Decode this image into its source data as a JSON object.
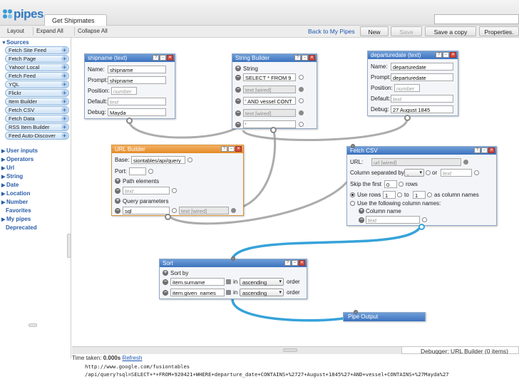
{
  "app": {
    "logo_text": "pipes",
    "pipe_tab_title": "Get Shipmates"
  },
  "toolbar": {
    "layout": "Layout",
    "expand_all": "Expand All",
    "collapse_all": "Collapse All",
    "back_link": "Back to My Pipes",
    "new": "New",
    "save": "Save",
    "save_copy": "Save a copy",
    "properties": "Properties."
  },
  "sidebar": {
    "sources_label": "Sources",
    "sources": [
      "Fetch Site Feed",
      "Fetch Page",
      "Yahoo! Local",
      "Fetch Feed",
      "YQL",
      "Flickr",
      "Item Builder",
      "Fetch CSV",
      "Fetch Data",
      "RSS Item Builder",
      "Feed Auto-Discover"
    ],
    "categories": [
      "User inputs",
      "Operators",
      "Url",
      "String",
      "Date",
      "Location",
      "Number"
    ],
    "extras": [
      "Favorites",
      "My pipes",
      "Deprecated"
    ]
  },
  "modules": {
    "shipname": {
      "title": "shipname (text)",
      "name_label": "Name:",
      "name_value": "shipname",
      "prompt_label": "Prompt:",
      "prompt_value": "shipname",
      "position_label": "Position:",
      "position_placeholder": "number",
      "default_label": "Default:",
      "default_placeholder": "text",
      "debug_label": "Debug:",
      "debug_value": "Mayda"
    },
    "string_builder": {
      "title": "String Builder",
      "section_label": "String",
      "items": [
        "SELECT * FROM 9",
        "text [wired]",
        "' AND vessel CONT",
        "text [wired]",
        "'"
      ]
    },
    "departuredate": {
      "title": "departuredate (text)",
      "name_label": "Name:",
      "name_value": "departuredate",
      "prompt_label": "Prompt:",
      "prompt_value": "departuredate",
      "position_label": "Position:",
      "position_placeholder": "number",
      "default_label": "Default:",
      "default_placeholder": "text",
      "debug_label": "Debug:",
      "debug_value": "27 August 1845"
    },
    "url_builder": {
      "title": "URL Builder",
      "base_label": "Base:",
      "base_value": "siontables/api/query",
      "port_label": "Port:",
      "path_label": "Path elements",
      "path_placeholder": "text",
      "query_label": "Query parameters",
      "query_key": "sql",
      "query_value": "text [wired]"
    },
    "fetch_csv": {
      "title": "Fetch CSV",
      "url_label": "URL:",
      "url_value": "url [wired]",
      "sep_label": "Column separated by",
      "sep_value": ",",
      "or_label": "or",
      "or_placeholder": "text",
      "skip_label": "Skip the first",
      "skip_value": "0",
      "skip_unit": "rows",
      "userows_label": "Use rows",
      "rows_from": "1",
      "to_label": "to",
      "rows_to": "1",
      "colnames_label": "as column names",
      "following_label": "Use the following column names:",
      "colname_label": "Column name",
      "colname_placeholder": "text"
    },
    "sort": {
      "title": "Sort",
      "sortby_label": "Sort by",
      "rows": [
        {
          "field": "item.surname",
          "in": "in",
          "order": "ascending",
          "suffix": "order"
        },
        {
          "field": "item.given_names",
          "in": "in",
          "order": "ascending",
          "suffix": "order"
        }
      ]
    },
    "pipe_output": {
      "title": "Pipe Output"
    }
  },
  "debugger": {
    "tab_label": "Debugger: URL Builder (0 items)",
    "time_label": "Time taken:",
    "time_value": "0.000s",
    "refresh_label": "Refresh",
    "output_line1": "http://www.google.com/fusiontables",
    "output_line2": "/api/query?sql=SELECT+*+FROM+920421+WHERE+departure_date+CONTAINS+%2727+August+1845%27+AND+vessel+CONTAINS+%27Mayda%27"
  },
  "colors": {
    "module_header": "#3c72be",
    "url_builder_header": "#e48a26",
    "wire_active": "#36a3d9",
    "wire_default": "#9a9a9a"
  }
}
